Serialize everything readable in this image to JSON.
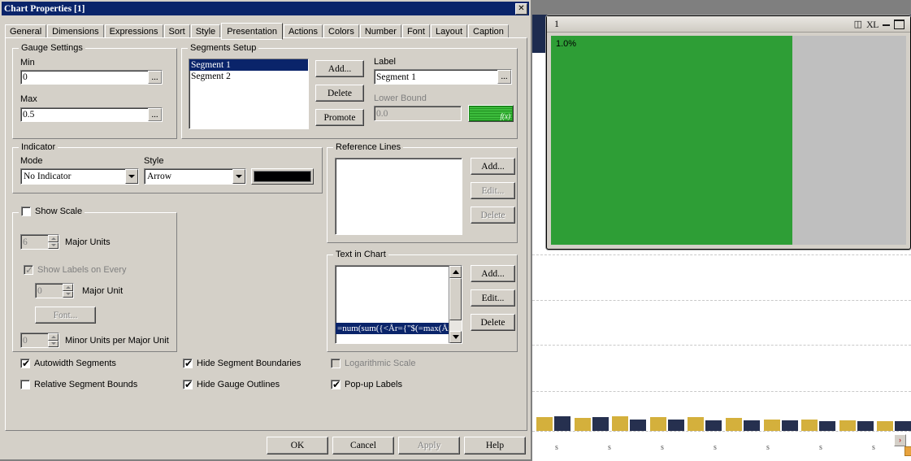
{
  "dialog": {
    "title": "Chart Properties [1]",
    "close_icon": "close-icon",
    "tabs": [
      {
        "label": "General",
        "active": false
      },
      {
        "label": "Dimensions",
        "active": false
      },
      {
        "label": "Expressions",
        "active": false
      },
      {
        "label": "Sort",
        "active": false
      },
      {
        "label": "Style",
        "active": false
      },
      {
        "label": "Presentation",
        "active": true
      },
      {
        "label": "Actions",
        "active": false
      },
      {
        "label": "Colors",
        "active": false
      },
      {
        "label": "Number",
        "active": false
      },
      {
        "label": "Font",
        "active": false
      },
      {
        "label": "Layout",
        "active": false
      },
      {
        "label": "Caption",
        "active": false
      }
    ],
    "gauge_settings": {
      "title": "Gauge Settings",
      "min_label": "Min",
      "min_value": "0",
      "max_label": "Max",
      "max_value": "0.5",
      "ellipsis": "..."
    },
    "segments_setup": {
      "title": "Segments Setup",
      "items": [
        "Segment 1",
        "Segment 2"
      ],
      "selected_index": 0,
      "add_label": "Add...",
      "delete_label": "Delete",
      "promote_label": "Promote",
      "label_caption": "Label",
      "label_value": "Segment 1",
      "lower_bound_caption": "Lower Bound",
      "lower_bound_value": "0.0",
      "ellipsis": "...",
      "fx_label": "f(x)",
      "fx_color": "#1d8a1d"
    },
    "indicator": {
      "title": "Indicator",
      "mode_caption": "Mode",
      "mode_value": "No Indicator",
      "style_caption": "Style",
      "style_value": "Arrow",
      "color": "#000000"
    },
    "show_scale": {
      "title": "Show Scale",
      "checked": false,
      "major_units_value": "6",
      "major_units_label": "Major Units",
      "show_labels_every_label": "Show Labels on Every",
      "show_labels_every_checked": true,
      "major_unit_value": "0",
      "major_unit_label": "Major Unit",
      "font_button": "Font...",
      "minor_units_value": "0",
      "minor_units_label": "Minor Units per Major Unit"
    },
    "reference_lines": {
      "title": "Reference Lines",
      "items": [],
      "add_label": "Add...",
      "edit_label": "Edit...",
      "delete_label": "Delete"
    },
    "text_in_chart": {
      "title": "Text in Chart",
      "items": [
        "=num(sum({<År={\"$(=max(År)"
      ],
      "selected_index": 0,
      "add_label": "Add...",
      "edit_label": "Edit...",
      "delete_label": "Delete"
    },
    "checkboxes": [
      {
        "label": "Autowidth Segments",
        "checked": true,
        "disabled": false
      },
      {
        "label": "Relative Segment Bounds",
        "checked": false,
        "disabled": false
      },
      {
        "label": "Hide Segment Boundaries",
        "checked": true,
        "disabled": false
      },
      {
        "label": "Hide Gauge Outlines",
        "checked": true,
        "disabled": false
      },
      {
        "label": "Logarithmic Scale",
        "checked": false,
        "disabled": true
      },
      {
        "label": "Pop-up Labels",
        "checked": true,
        "disabled": false
      }
    ],
    "footer": {
      "ok": "OK",
      "cancel": "Cancel",
      "apply": "Apply",
      "apply_disabled": true,
      "help": "Help"
    }
  },
  "chart_window": {
    "title": "1",
    "icons": [
      "table-export-icon",
      "XL",
      "minimize-icon",
      "maximize-icon"
    ],
    "gauge": {
      "value_label": "1.0%",
      "fill_percent": 68,
      "fill_color": "#2e9e36",
      "track_color": "#bfbfbf"
    }
  },
  "chart_data": {
    "type": "bar",
    "title": "",
    "xlabel": "",
    "ylabel": "",
    "series": [
      {
        "name": "series-gold",
        "color": "#d4b03c",
        "values": [
          11,
          10,
          12,
          11,
          11,
          10,
          9,
          9,
          8,
          7
        ]
      },
      {
        "name": "series-navy",
        "color": "#26304f",
        "values": [
          12,
          11,
          9,
          9,
          8,
          8,
          8,
          7,
          7,
          7
        ]
      }
    ],
    "categories": [
      "",
      "",
      "",
      "",
      "",
      "",
      "",
      "",
      "",
      ""
    ],
    "tick_labels": [
      "s",
      "s",
      "s",
      "s",
      "s",
      "s",
      "s"
    ],
    "grid": true,
    "legend": "none"
  },
  "scroll_button": {
    "glyph": "›",
    "color": "#c03030"
  }
}
